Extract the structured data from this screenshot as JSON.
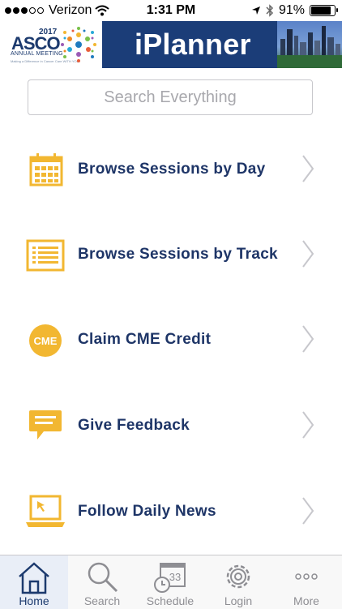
{
  "status_bar": {
    "carrier": "Verizon",
    "time": "1:31 PM",
    "battery": "91%",
    "battery_level": 0.91,
    "signal_dots": 5,
    "signal_filled": 3
  },
  "header": {
    "logo_year": "2017",
    "logo_brand": "ASCO",
    "logo_subtitle": "ANNUAL MEETING",
    "logo_tagline": "Making a Difference in Cancer Care WITH YOU",
    "app_title": "iPlanner",
    "brand_color": "#1b3d78"
  },
  "search": {
    "placeholder": "Search Everything"
  },
  "menu": {
    "items": [
      {
        "label": "Browse Sessions by Day",
        "icon": "calendar-icon"
      },
      {
        "label": "Browse Sessions by Track",
        "icon": "list-icon"
      },
      {
        "label": "Claim CME Credit",
        "icon": "cme-badge-icon",
        "badge": "CME"
      },
      {
        "label": "Give Feedback",
        "icon": "speech-bubble-icon"
      },
      {
        "label": "Follow Daily News",
        "icon": "laptop-icon"
      }
    ],
    "icon_color": "#f2b731",
    "label_color": "#1e3567"
  },
  "tabbar": {
    "tabs": [
      {
        "label": "Home",
        "icon": "home-icon",
        "active": true
      },
      {
        "label": "Search",
        "icon": "magnifier-icon",
        "active": false
      },
      {
        "label": "Schedule",
        "icon": "schedule-icon",
        "active": false,
        "badge": "33"
      },
      {
        "label": "Login",
        "icon": "gear-icon",
        "active": false
      },
      {
        "label": "More",
        "icon": "ellipsis-icon",
        "active": false
      }
    ]
  }
}
